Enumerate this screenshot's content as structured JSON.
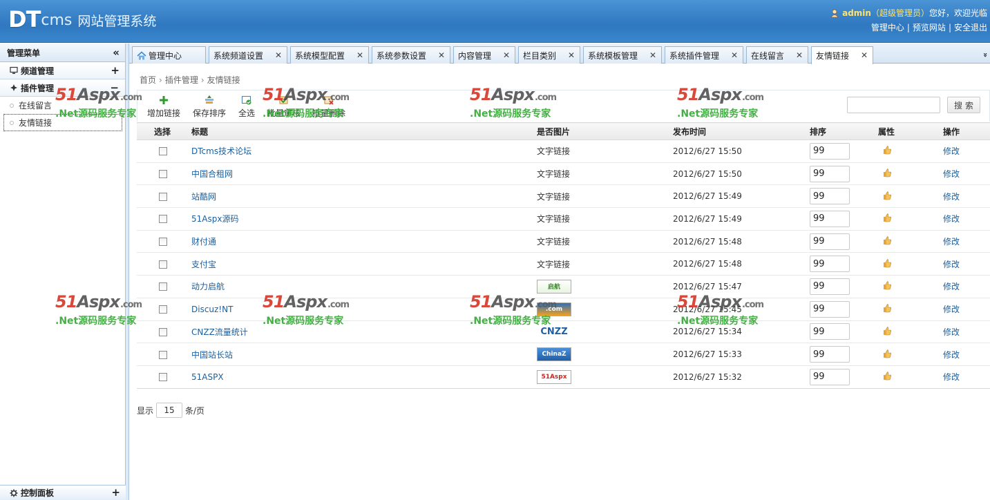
{
  "header": {
    "logo_main": "DT",
    "logo_cms": "cms",
    "logo_subtitle": "网站管理系统",
    "user_name": "admin",
    "user_role": "（超级管理员）",
    "greeting": "您好，欢迎光临",
    "links": [
      "管理中心",
      "预览网站",
      "安全退出"
    ],
    "link_sep": "|"
  },
  "sidebar": {
    "title": "管理菜单",
    "collapse_glyph": "«",
    "groups": [
      {
        "label": "频道管理",
        "toggle": "+"
      },
      {
        "label": "插件管理",
        "toggle": "−"
      }
    ],
    "items": [
      {
        "label": "在线留言"
      },
      {
        "label": "友情链接"
      }
    ],
    "footer": {
      "label": "控制面板",
      "toggle": "+"
    }
  },
  "tabs": [
    {
      "label": "管理中心"
    },
    {
      "label": "系统频道设置",
      "close": "✕"
    },
    {
      "label": "系统模型配置",
      "close": "✕"
    },
    {
      "label": "系统参数设置",
      "close": "✕"
    },
    {
      "label": "内容管理",
      "close": "✕"
    },
    {
      "label": "栏目类别",
      "close": "✕"
    },
    {
      "label": "系统模板管理",
      "close": "✕"
    },
    {
      "label": "系统插件管理",
      "close": "✕"
    },
    {
      "label": "在线留言",
      "close": "✕"
    },
    {
      "label": "友情链接",
      "close": "✕"
    }
  ],
  "tab_scroll_glyph": "»",
  "breadcrumb": {
    "items": [
      "首页",
      "插件管理",
      "友情链接"
    ],
    "arrow": "›"
  },
  "toolbar": {
    "add": "增加链接",
    "save_sort": "保存排序",
    "select_all": "全选",
    "batch_audit": "批量审核",
    "batch_delete": "批量删除",
    "search_button": "搜索",
    "search_value": ""
  },
  "table": {
    "headers": {
      "select": "选择",
      "title": "标题",
      "is_image": "是否图片",
      "time": "发布时间",
      "sort": "排序",
      "attr": "属性",
      "op": "操作"
    },
    "rows": [
      {
        "title": "DTcms技术论坛",
        "type": "文字链接",
        "time": "2012/6/27 15:50",
        "sort": "99",
        "op": "修改"
      },
      {
        "title": "中国合租网",
        "type": "文字链接",
        "time": "2012/6/27 15:50",
        "sort": "99",
        "op": "修改"
      },
      {
        "title": "站酷网",
        "type": "文字链接",
        "time": "2012/6/27 15:49",
        "sort": "99",
        "op": "修改"
      },
      {
        "title": "51Aspx源码",
        "type": "文字链接",
        "time": "2012/6/27 15:49",
        "sort": "99",
        "op": "修改"
      },
      {
        "title": "财付通",
        "type": "文字链接",
        "time": "2012/6/27 15:48",
        "sort": "99",
        "op": "修改"
      },
      {
        "title": "支付宝",
        "type": "文字链接",
        "time": "2012/6/27 15:48",
        "sort": "99",
        "op": "修改"
      },
      {
        "title": "动力启航",
        "logo_text": "启航",
        "time": "2012/6/27 15:47",
        "sort": "99",
        "op": "修改"
      },
      {
        "title": "Discuz!NT",
        "logo_text": ".com",
        "time": "2012/6/27 15:45",
        "sort": "99",
        "op": "修改"
      },
      {
        "title": "CNZZ流量统计",
        "logo_text": "CNZZ",
        "time": "2012/6/27 15:34",
        "sort": "99",
        "op": "修改"
      },
      {
        "title": "中国站长站",
        "logo_text": "ChinaZ",
        "time": "2012/6/27 15:33",
        "sort": "99",
        "op": "修改"
      },
      {
        "title": "51ASPX",
        "logo_text": "51Aspx",
        "time": "2012/6/27 15:32",
        "sort": "99",
        "op": "修改"
      }
    ]
  },
  "pager": {
    "prefix": "显示",
    "value": "15",
    "suffix": "条/页"
  },
  "watermark": {
    "brand_red": "51",
    "brand_gray": "Aspx",
    "brand_com": ".com",
    "tagline": ".Net源码服务专家"
  },
  "colors": {
    "header_blue": "#3a86cc",
    "link_blue": "#1a5f9e",
    "watermark_red": "#d63a2a",
    "watermark_green": "#3caa3c"
  }
}
